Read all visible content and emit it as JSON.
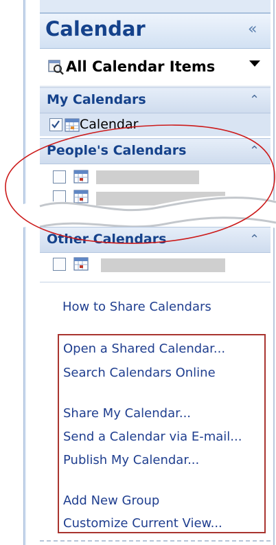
{
  "title": "Calendar",
  "view_selector": {
    "label": "All Calendar Items"
  },
  "groups": {
    "my_calendars": {
      "label": "My Calendars",
      "items": [
        {
          "label": "Calendar",
          "checked": true
        }
      ]
    },
    "peoples_calendars": {
      "label": "People's Calendars"
    },
    "other_calendars": {
      "label": "Other Calendars"
    }
  },
  "links": {
    "share_help": "How to Share Calendars",
    "open_shared": "Open a Shared Calendar...",
    "search_online": "Search Calendars Online",
    "share_my": "Share My Calendar...",
    "send_email": "Send a Calendar via E-mail...",
    "publish": "Publish My Calendar...",
    "add_group": "Add New Group",
    "customize_view": "Customize Current View..."
  },
  "icons": {
    "collapse": "double-chevron-left-icon",
    "group_collapse": "double-chevron-up-icon",
    "dropdown": "triangle-down-icon"
  },
  "colors": {
    "header_text": "#15428b",
    "link_text": "#1f3e8f",
    "annotation_red": "#cc1a1a",
    "box_red": "#a8332e"
  }
}
